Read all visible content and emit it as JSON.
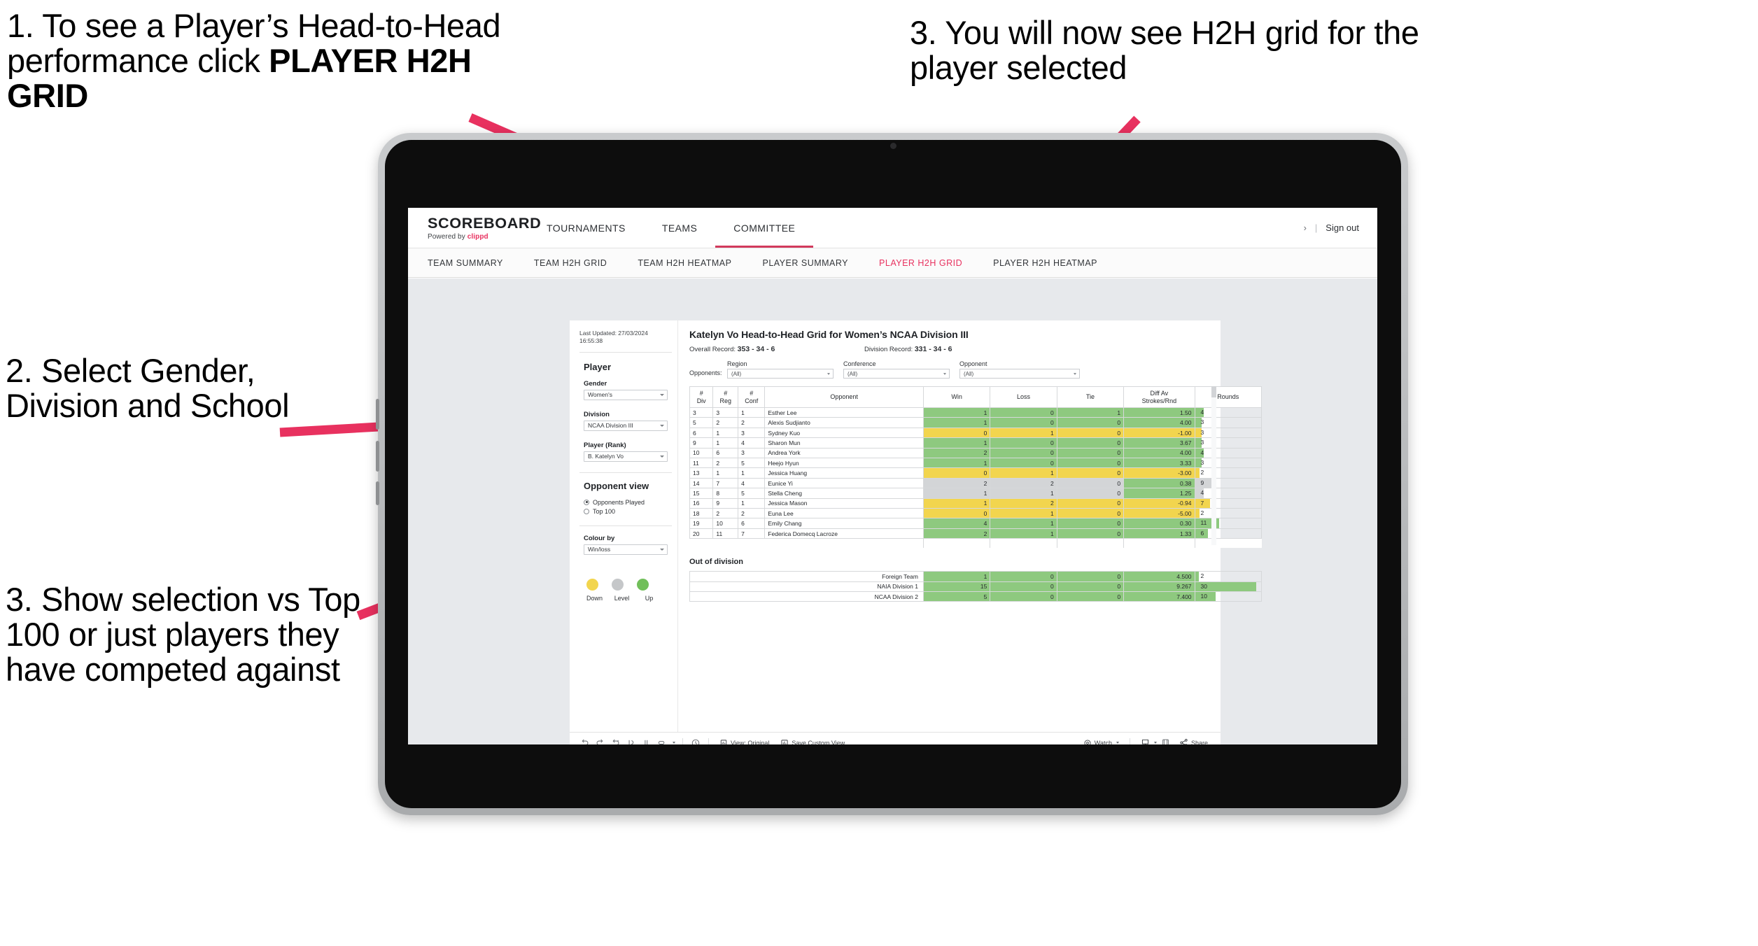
{
  "annotations": {
    "step1": "1. To see a Player’s Head-to-Head performance click ",
    "step1_bold": "PLAYER H2H GRID",
    "step2": "2. Select Gender, Division and School",
    "step3_left": "3. Show selection vs Top 100 or just players they have competed against",
    "step3_right": "3. You will now see H2H grid for the player selected",
    "arrow_color": "#e8315f"
  },
  "header": {
    "logo_word": "SCOREBOARD",
    "logo_sub_prefix": "Powered by ",
    "logo_sub_brand": "clippd",
    "nav": [
      {
        "label": "TOURNAMENTS",
        "active": false
      },
      {
        "label": "TEAMS",
        "active": false
      },
      {
        "label": "COMMITTEE",
        "active": true
      }
    ],
    "chevron": "›",
    "separator": "|",
    "sign_out": "Sign out"
  },
  "subnav": [
    {
      "label": "TEAM SUMMARY",
      "active": false
    },
    {
      "label": "TEAM H2H GRID",
      "active": false
    },
    {
      "label": "TEAM H2H HEATMAP",
      "active": false
    },
    {
      "label": "PLAYER SUMMARY",
      "active": false
    },
    {
      "label": "PLAYER H2H GRID",
      "active": true
    },
    {
      "label": "PLAYER H2H HEATMAP",
      "active": false
    }
  ],
  "panel": {
    "last_updated": "Last Updated: 27/03/2024 16:55:38",
    "section_player": "Player",
    "gender_label": "Gender",
    "gender_value": "Women's",
    "division_label": "Division",
    "division_value": "NCAA Division III",
    "player_label": "Player (Rank)",
    "player_value": "B. Katelyn Vo",
    "opponent_view_label": "Opponent view",
    "opponent_options": [
      {
        "label": "Opponents Played",
        "selected": true
      },
      {
        "label": "Top 100",
        "selected": false
      }
    ],
    "colour_by_label": "Colour by",
    "colour_by_value": "Win/loss",
    "legend": [
      {
        "label": "Down",
        "color": "#f2d54e"
      },
      {
        "label": "Level",
        "color": "#c5c7c9"
      },
      {
        "label": "Up",
        "color": "#71bf5a"
      }
    ]
  },
  "viz": {
    "title": "Katelyn Vo Head-to-Head Grid for Women’s NCAA Division III",
    "overall_record_label": "Overall Record: ",
    "overall_record_value": "353 -  34 - 6",
    "division_record_label": "Division Record: ",
    "division_record_value": "331 -  34 - 6",
    "opponents_label": "Opponents:",
    "filters": [
      {
        "label": "Region",
        "value": "(All)"
      },
      {
        "label": "Conference",
        "value": "(All)"
      },
      {
        "label": "Opponent",
        "value": "(All)"
      }
    ],
    "columns": [
      "# Div",
      "# Reg",
      "# Conf",
      "Opponent",
      "Win",
      "Loss",
      "Tie",
      "Diff Av Strokes/Rnd",
      "Rounds"
    ],
    "column_lines": [
      [
        "#",
        "Div"
      ],
      [
        "#",
        "Reg"
      ],
      [
        "#",
        "Conf"
      ],
      [
        "Opponent"
      ],
      [
        "Win"
      ],
      [
        "Loss"
      ],
      [
        "Tie"
      ],
      [
        "Diff Av",
        "Strokes/Rnd"
      ],
      [
        "Rounds"
      ]
    ],
    "rows": [
      {
        "div": "3",
        "reg": "3",
        "conf": "1",
        "opponent": "Esther Lee",
        "win": "1",
        "loss": "0",
        "tie": "1",
        "diff": "1.50",
        "rounds": "4",
        "state": "up",
        "bar_pct": 13
      },
      {
        "div": "5",
        "reg": "2",
        "conf": "2",
        "opponent": "Alexis Sudjianto",
        "win": "1",
        "loss": "0",
        "tie": "0",
        "diff": "4.00",
        "rounds": "3",
        "state": "up",
        "bar_pct": 10
      },
      {
        "div": "6",
        "reg": "1",
        "conf": "3",
        "opponent": "Sydney Kuo",
        "win": "0",
        "loss": "1",
        "tie": "0",
        "diff": "-1.00",
        "rounds": "3",
        "state": "down",
        "bar_pct": 10
      },
      {
        "div": "9",
        "reg": "1",
        "conf": "4",
        "opponent": "Sharon Mun",
        "win": "1",
        "loss": "0",
        "tie": "0",
        "diff": "3.67",
        "rounds": "3",
        "state": "up",
        "bar_pct": 10
      },
      {
        "div": "10",
        "reg": "6",
        "conf": "3",
        "opponent": "Andrea York",
        "win": "2",
        "loss": "0",
        "tie": "0",
        "diff": "4.00",
        "rounds": "4",
        "state": "up",
        "bar_pct": 13
      },
      {
        "div": "11",
        "reg": "2",
        "conf": "5",
        "opponent": "Heejo Hyun",
        "win": "1",
        "loss": "0",
        "tie": "0",
        "diff": "3.33",
        "rounds": "3",
        "state": "up",
        "bar_pct": 10
      },
      {
        "div": "13",
        "reg": "1",
        "conf": "1",
        "opponent": "Jessica Huang",
        "win": "0",
        "loss": "1",
        "tie": "0",
        "diff": "-3.00",
        "rounds": "2",
        "state": "down",
        "bar_pct": 7
      },
      {
        "div": "14",
        "reg": "7",
        "conf": "4",
        "opponent": "Eunice Yi",
        "win": "2",
        "loss": "2",
        "tie": "0",
        "diff": "0.38",
        "rounds": "9",
        "state": "level",
        "bar_pct": 30
      },
      {
        "div": "15",
        "reg": "8",
        "conf": "5",
        "opponent": "Stella Cheng",
        "win": "1",
        "loss": "1",
        "tie": "0",
        "diff": "1.25",
        "rounds": "4",
        "state": "level",
        "bar_pct": 13
      },
      {
        "div": "16",
        "reg": "9",
        "conf": "1",
        "opponent": "Jessica Mason",
        "win": "1",
        "loss": "2",
        "tie": "0",
        "diff": "-0.94",
        "rounds": "7",
        "state": "down",
        "bar_pct": 23
      },
      {
        "div": "18",
        "reg": "2",
        "conf": "2",
        "opponent": "Euna Lee",
        "win": "0",
        "loss": "1",
        "tie": "0",
        "diff": "-5.00",
        "rounds": "2",
        "state": "down",
        "bar_pct": 7
      },
      {
        "div": "19",
        "reg": "10",
        "conf": "6",
        "opponent": "Emily Chang",
        "win": "4",
        "loss": "1",
        "tie": "0",
        "diff": "0.30",
        "rounds": "11",
        "state": "up",
        "bar_pct": 37
      },
      {
        "div": "20",
        "reg": "11",
        "conf": "7",
        "opponent": "Federica Domecq Lacroze",
        "win": "2",
        "loss": "1",
        "tie": "0",
        "diff": "1.33",
        "rounds": "6",
        "state": "up",
        "bar_pct": 20
      }
    ],
    "out_of_division_title": "Out of division",
    "out_of_division": [
      {
        "name": "Foreign Team",
        "win": "1",
        "loss": "0",
        "tie": "0",
        "diff": "4.500",
        "rounds": "2",
        "state": "up",
        "bar_pct": 6
      },
      {
        "name": "NAIA Division 1",
        "win": "15",
        "loss": "0",
        "tie": "0",
        "diff": "9.267",
        "rounds": "30",
        "state": "up",
        "bar_pct": 93
      },
      {
        "name": "NCAA Division 2",
        "win": "5",
        "loss": "0",
        "tie": "0",
        "diff": "7.400",
        "rounds": "10",
        "state": "up",
        "bar_pct": 31
      }
    ],
    "colors": {
      "up": "#8ec97f",
      "down": "#f2d54e",
      "level": "#d3d5d7"
    }
  },
  "toolbar": {
    "view_label": "View: Original",
    "save_label": "Save Custom View",
    "watch_label": "Watch",
    "share_label": "Share"
  }
}
